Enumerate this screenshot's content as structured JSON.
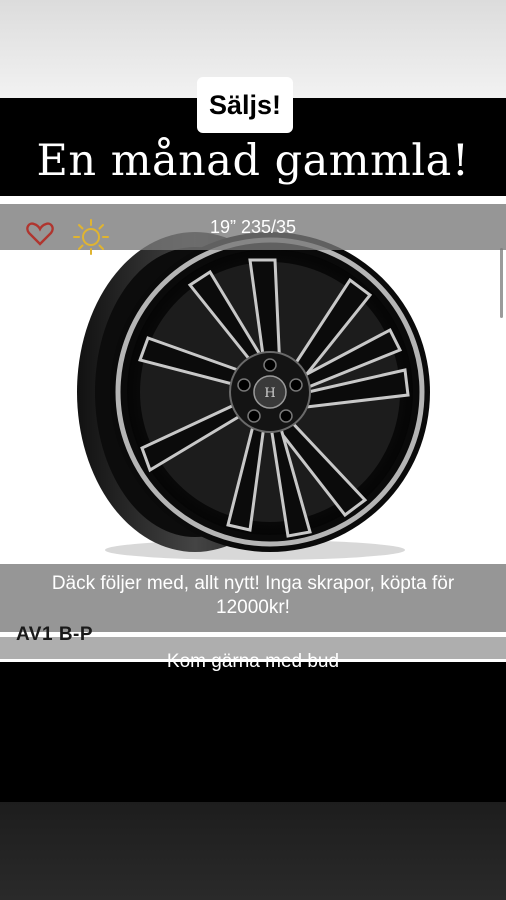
{
  "story": {
    "sticker_label": "Säljs!",
    "headline": "En månad gammla!",
    "size_caption": "19” 235/35",
    "description": "Däck följer med, allt nytt! Inga skrapor, köpta för 12000kr!",
    "brand_model": "AV1 B-P",
    "call_to_action": "Kom gärna med bud"
  },
  "icons": {
    "favorite": "heart-icon",
    "brightness": "sun-icon"
  },
  "colors": {
    "background": "#000000",
    "overlay_band": "#787878",
    "heart": "#b0352f",
    "sun": "#e0b430"
  }
}
